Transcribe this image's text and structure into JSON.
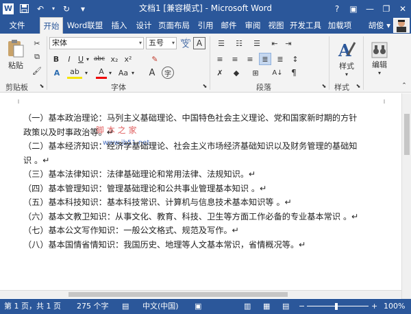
{
  "window": {
    "title": "文档1 [兼容模式] - Microsoft Word",
    "help": "?",
    "minimize": "—",
    "restore": "❐",
    "close": "✕"
  },
  "qat": {
    "word_icon": "W",
    "save_icon": "💾",
    "undo_icon": "↶",
    "redo_icon": "↻",
    "customize_icon": "▾"
  },
  "tabs": {
    "file": "文件",
    "items": [
      "开始",
      "Word联盟",
      "插入",
      "设计",
      "页面布局",
      "引用",
      "邮件",
      "审阅",
      "视图",
      "开发工具",
      "加载项"
    ],
    "user": "胡俊 ▾"
  },
  "ribbon": {
    "clipboard": {
      "paste": "粘贴",
      "label": "剪贴板"
    },
    "font": {
      "name": "宋体",
      "size": "五号",
      "label": "字体",
      "wen": "wén",
      "A": "A",
      "bold": "B",
      "italic": "I",
      "underline": "U",
      "strike": "abc",
      "sub": "x₂",
      "sup": "x²",
      "clear": "Aa",
      "grow": "A",
      "shrink": "A",
      "highlight": "ab",
      "fontcolor": "A",
      "case": "Aa",
      "Acirc": "A"
    },
    "paragraph": {
      "label": "段落"
    },
    "styles": {
      "label": "样式",
      "btn": "样式"
    },
    "editing": {
      "btn": "编辑"
    }
  },
  "document": {
    "lines": [
      "（一）基本政治理论：马列主义基础理论、中国特色社会主义理论、党和国家新时期的方针",
      "政策以及时事政治等。↵",
      "（二）基本经济知识：经济学基础理论、社会主义市场经济基础知识以及财务管理的基础知",
      "识 。↵",
      "（三）基本法律知识：法律基础理论和常用法律、法规知识。↵",
      "（四）基本管理知识：管理基础理论和公共事业管理基本知识 。↵",
      "（五）基本科技知识：基本科技常识、计算机与信息技术基本知识等 。↵",
      "（六）基本文教卫知识：从事文化、教育、科技、卫生等方面工作必备的专业基本常识 。↵",
      "（七）基本公文写作知识：一般公文格式、规范及写作。↵",
      "（八）基本国情省情知识：我国历史、地理等人文基本常识，省情概况等。↵"
    ],
    "watermark": "脚 本 之 家",
    "watermark_url": "www.jb51.net"
  },
  "status": {
    "page": "第 1 页，共 1 页",
    "words": "275 个字",
    "language": "中文(中国)",
    "zoom": "100%",
    "minus": "−",
    "plus": "+"
  },
  "colors": {
    "accent": "#2b579a"
  }
}
